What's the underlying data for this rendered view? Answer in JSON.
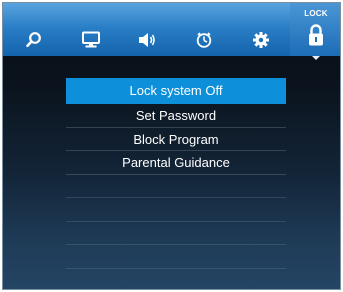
{
  "tabs": [
    {
      "icon": "search-icon"
    },
    {
      "icon": "monitor-icon"
    },
    {
      "icon": "speaker-icon"
    },
    {
      "icon": "clock-icon"
    },
    {
      "icon": "gear-icon"
    },
    {
      "icon": "lock-icon",
      "label": "LOCK",
      "active": true
    }
  ],
  "menu": {
    "items": [
      {
        "label": "Lock system Off",
        "selected": true
      },
      {
        "label": "Set Password"
      },
      {
        "label": "Block Program"
      },
      {
        "label": "Parental Guidance"
      }
    ]
  },
  "colors": {
    "topbar": "#2a7fc6",
    "selection": "#0e8fda",
    "text": "#ffffff",
    "background": "#0b141e"
  }
}
